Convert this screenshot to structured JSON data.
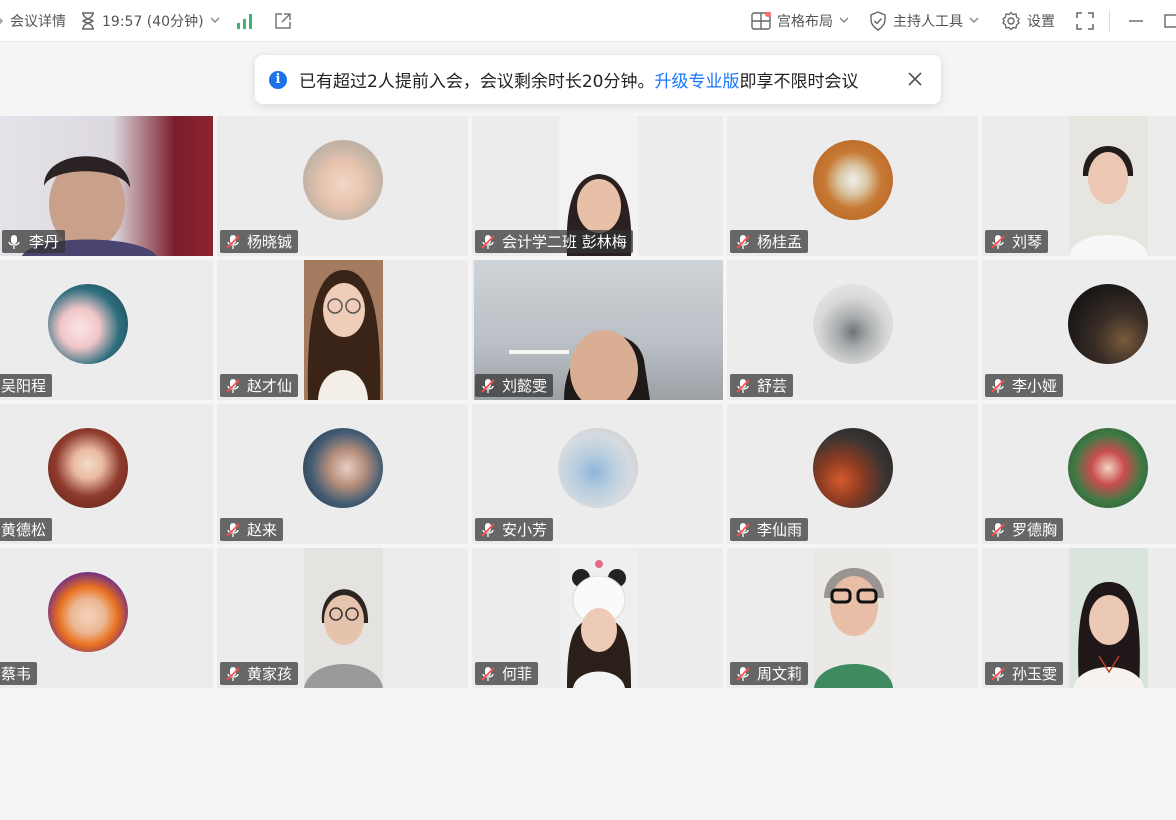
{
  "toolbar": {
    "meeting_details": "会议详情",
    "timer": "19:57 (40分钟)",
    "grid_layout": "宫格布局",
    "host_tools": "主持人工具",
    "settings": "设置"
  },
  "notice": {
    "text_before": "已有超过2人提前入会，会议剩余时长20分钟。",
    "link": "升级专业版",
    "text_after": "即享不限时会议"
  },
  "participants": [
    {
      "name": "李丹",
      "mic": "on"
    },
    {
      "name": "杨晓铖",
      "mic": "muted"
    },
    {
      "name": "会计学二班 彭林梅",
      "mic": "muted"
    },
    {
      "name": "杨桂孟",
      "mic": "muted"
    },
    {
      "name": "刘琴",
      "mic": "muted"
    },
    {
      "name": "吴阳程",
      "mic": "muted"
    },
    {
      "name": "赵才仙",
      "mic": "muted"
    },
    {
      "name": "刘懿雯",
      "mic": "muted"
    },
    {
      "name": "舒芸",
      "mic": "muted"
    },
    {
      "name": "李小娅",
      "mic": "muted"
    },
    {
      "name": "黄德松",
      "mic": "muted"
    },
    {
      "name": "赵来",
      "mic": "muted"
    },
    {
      "name": "安小芳",
      "mic": "muted"
    },
    {
      "name": "李仙雨",
      "mic": "muted"
    },
    {
      "name": "罗德胸",
      "mic": "muted"
    },
    {
      "name": "蔡韦",
      "mic": "muted"
    },
    {
      "name": "黄家孩",
      "mic": "muted"
    },
    {
      "name": "何菲",
      "mic": "muted"
    },
    {
      "name": "周文莉",
      "mic": "muted"
    },
    {
      "name": "孙玉雯",
      "mic": "muted"
    }
  ],
  "colors": {
    "accent": "#1677ff",
    "tile_bg": "#ececec",
    "name_tag_bg": "#323232",
    "timer_icon": "#3cb371"
  }
}
